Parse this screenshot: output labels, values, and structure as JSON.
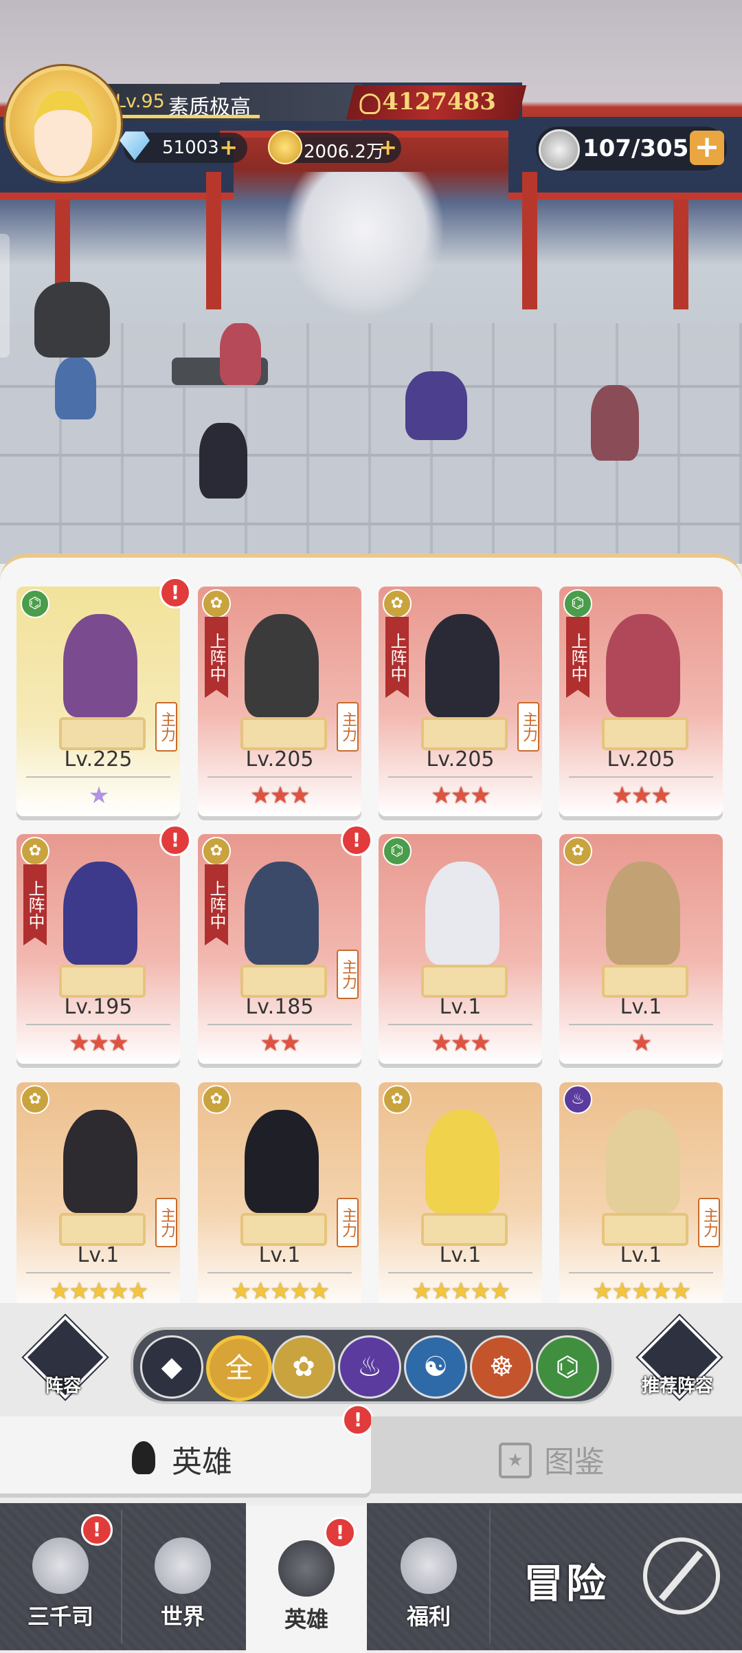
{
  "player": {
    "level": "Lv.95",
    "name": "素质极高",
    "power": "4127483",
    "gems": "51003",
    "gold": "2006.2万",
    "stamina": "107/305"
  },
  "heroes": [
    {
      "level": "Lv.225",
      "stars": "★",
      "star_color": "purple",
      "faction": "green",
      "deployed": false,
      "main": true,
      "alert": true,
      "bg": "yellow",
      "figure_color": "#7a4b8f"
    },
    {
      "level": "Lv.205",
      "stars": "★★★",
      "star_color": "red",
      "faction": "gold",
      "deployed": true,
      "main": true,
      "alert": false,
      "bg": "red",
      "figure_color": "#3b3b3b"
    },
    {
      "level": "Lv.205",
      "stars": "★★★",
      "star_color": "red",
      "faction": "gold",
      "deployed": true,
      "main": true,
      "alert": false,
      "bg": "red",
      "figure_color": "#2a2a36"
    },
    {
      "level": "Lv.205",
      "stars": "★★★",
      "star_color": "red",
      "faction": "green",
      "deployed": true,
      "main": false,
      "alert": false,
      "bg": "red",
      "figure_color": "#b0485a"
    },
    {
      "level": "Lv.195",
      "stars": "★★★",
      "star_color": "red",
      "faction": "gold",
      "deployed": true,
      "main": false,
      "alert": true,
      "bg": "red",
      "figure_color": "#3d3a8c"
    },
    {
      "level": "Lv.185",
      "stars": "★★",
      "star_color": "red",
      "faction": "gold",
      "deployed": true,
      "main": true,
      "alert": true,
      "bg": "red",
      "figure_color": "#3c4a6a"
    },
    {
      "level": "Lv.1",
      "stars": "★★★",
      "star_color": "red",
      "faction": "green",
      "deployed": false,
      "main": false,
      "alert": false,
      "bg": "red",
      "figure_color": "#e8e8ef"
    },
    {
      "level": "Lv.1",
      "stars": "★",
      "star_color": "red",
      "faction": "gold",
      "deployed": false,
      "main": false,
      "alert": false,
      "bg": "red",
      "figure_color": "#c2a274"
    },
    {
      "level": "Lv.1",
      "stars": "★★★★★",
      "star_color": "gold",
      "faction": "gold",
      "deployed": false,
      "main": true,
      "alert": false,
      "bg": "orange",
      "figure_color": "#2d2a30"
    },
    {
      "level": "Lv.1",
      "stars": "★★★★★",
      "star_color": "gold",
      "faction": "gold",
      "deployed": false,
      "main": true,
      "alert": false,
      "bg": "orange",
      "figure_color": "#1f1f28"
    },
    {
      "level": "Lv.1",
      "stars": "★★★★★",
      "star_color": "gold",
      "faction": "gold",
      "deployed": false,
      "main": false,
      "alert": false,
      "bg": "orange",
      "figure_color": "#f1d24c"
    },
    {
      "level": "Lv.1",
      "stars": "★★★★★",
      "star_color": "gold",
      "faction": "purple",
      "deployed": false,
      "main": true,
      "alert": false,
      "bg": "orange",
      "figure_color": "#e4cf9a"
    }
  ],
  "card_labels": {
    "deployed": "上阵中",
    "main": "主力"
  },
  "lineup_label": "阵容",
  "recommended_label": "推荐阵容",
  "filters": [
    {
      "name": "special",
      "glyph": "◆",
      "color": "#2d3140"
    },
    {
      "name": "all",
      "glyph": "全",
      "color": "#d9a437",
      "active": true
    },
    {
      "name": "lotus",
      "glyph": "✿",
      "color": "#c9a33e"
    },
    {
      "name": "flame",
      "glyph": "♨",
      "color": "#5b3b9e"
    },
    {
      "name": "taichi",
      "glyph": "☯",
      "color": "#2f6aa8"
    },
    {
      "name": "meditate",
      "glyph": "☸",
      "color": "#c4542b"
    },
    {
      "name": "dna",
      "glyph": "⌬",
      "color": "#3f8f3f"
    }
  ],
  "tabs": {
    "hero": "英雄",
    "dex": "图鉴"
  },
  "nav": {
    "sanqiansi": "三千司",
    "world": "世界",
    "hero": "英雄",
    "welfare": "福利",
    "adventure": "冒险"
  },
  "colors": {
    "alert": "#e23b3b",
    "deployed_ribbon": "#b02f2f",
    "accent_gold": "#f3c53a"
  }
}
